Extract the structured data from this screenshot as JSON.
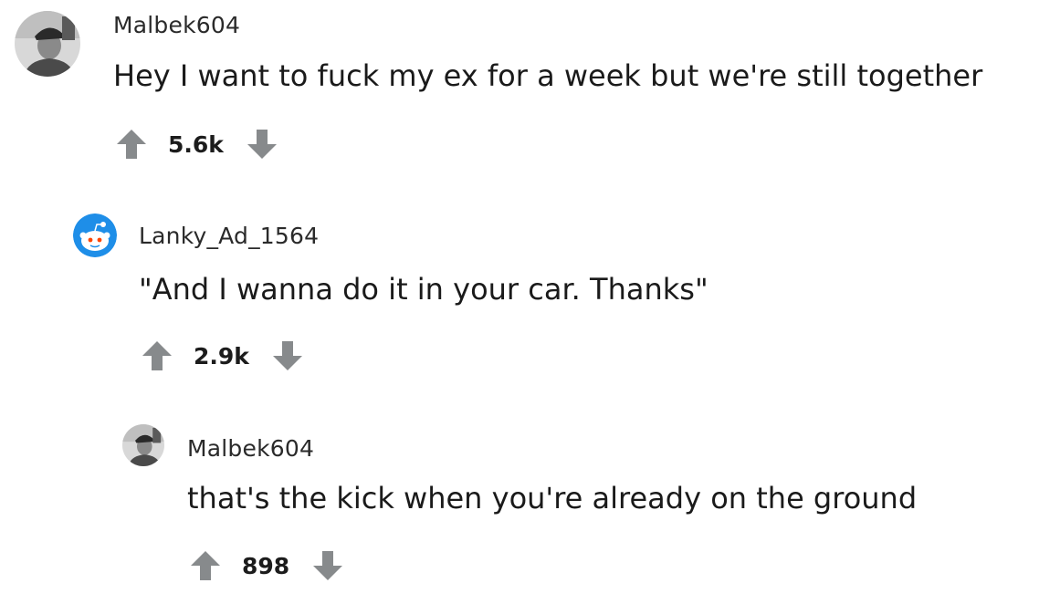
{
  "comments": [
    {
      "username": "Malbek604",
      "body": "Hey I want to fuck my ex for a week but we're still together",
      "score": "5.6k",
      "avatar": "photo-avatar-icon"
    },
    {
      "username": "Lanky_Ad_1564",
      "body": "\"And I wanna do it in your car. Thanks\"",
      "score": "2.9k",
      "avatar": "snoo-avatar-icon",
      "accent_color": "#1e8ee8"
    },
    {
      "username": "Malbek604",
      "body": "that's the kick when you're already on the ground",
      "score": "898",
      "avatar": "photo-avatar-icon"
    }
  ],
  "colors": {
    "arrow": "#878a8c",
    "text": "#1a1a1a"
  }
}
